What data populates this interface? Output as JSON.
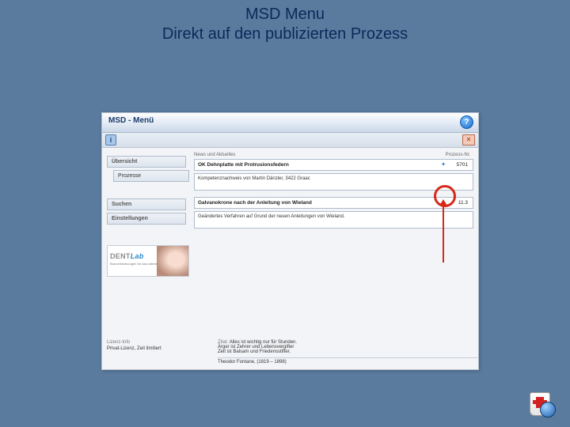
{
  "slide": {
    "title_line1": "MSD Menu",
    "title_line2": "Direkt auf den publizierten Prozess"
  },
  "window": {
    "title": "MSD - Menü"
  },
  "toolbar": {
    "info_glyph": "i",
    "help_glyph": "?",
    "close_glyph": "✕"
  },
  "sidebar": {
    "items": [
      {
        "label": "Übersicht",
        "kind": "head"
      },
      {
        "label": "Prozesse",
        "kind": "sub"
      },
      {
        "label": "Suchen",
        "kind": "head"
      },
      {
        "label": "Einstellungen",
        "kind": "head"
      }
    ],
    "logo": {
      "brand1": "DENT",
      "brand2": "Lab",
      "tagline": "Branchenlösungen für das zahntechnische Labor"
    }
  },
  "news": {
    "header_left": "News und Aktuelles",
    "header_right": "Prozess-Nr.",
    "items": [
      {
        "title": "OK Dehnplatte mit Protrusionsfedern",
        "number": "5701",
        "has_star": true,
        "desc": "Kompetenznachweis von Martin Dänzler, 3422 Graac"
      },
      {
        "title": "Galvanokrone nach der Anleitung von Wieland",
        "number": "11.3",
        "has_star": true,
        "desc": "Geändertes Verfahren auf Grund der neuen Anleitungen von Wieland."
      }
    ]
  },
  "footer": {
    "license_label": "Lizenz-Info",
    "license_value": "Privat-Lizenz, Zeit limitiert",
    "quote_label": "Zitat:",
    "quote_l1": "Alles ist wichtig nur für Stunden.",
    "quote_l2": "Ärger ist Zehrer und Lebensvergifter",
    "quote_l3": "Zeit ist Balsam und Friedensstifter.",
    "quote_attr": "Theodor Fontane, (1819 – 1898)"
  }
}
